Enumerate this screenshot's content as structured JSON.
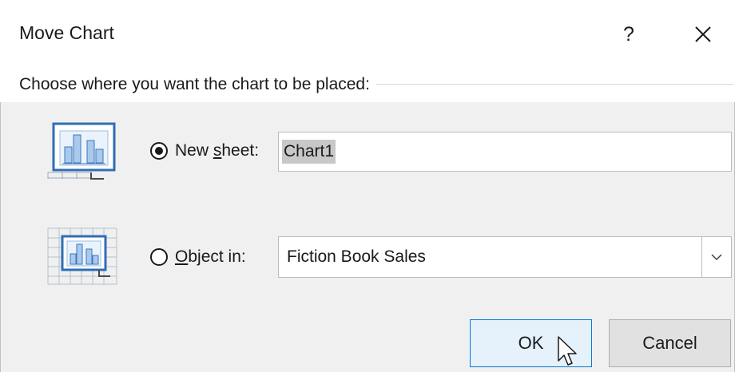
{
  "dialog": {
    "title": "Move Chart",
    "help_label": "?",
    "prompt": "Choose where you want the chart to be placed:"
  },
  "options": {
    "new_sheet": {
      "label_pre": "New ",
      "label_accel": "s",
      "label_post": "heet:",
      "checked": true,
      "value": "Chart1"
    },
    "object_in": {
      "label_pre": "",
      "label_accel": "O",
      "label_post": "bject in:",
      "checked": false,
      "selected": "Fiction Book Sales"
    }
  },
  "buttons": {
    "ok": "OK",
    "cancel": "Cancel"
  },
  "icons": {
    "new_sheet": "chart-sheet-icon",
    "object_in": "chart-object-icon",
    "close": "close-icon",
    "dropdown": "chevron-down-icon",
    "cursor": "mouse-pointer-icon"
  },
  "colors": {
    "accent": "#0078d7",
    "ok_fill": "#e5f1fb",
    "dialog_bg": "#f0f0f0",
    "selection": "#c8c8c8"
  }
}
